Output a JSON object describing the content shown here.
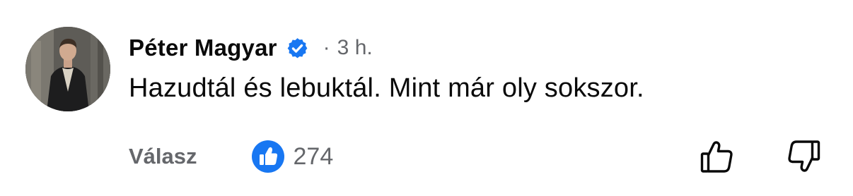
{
  "comment": {
    "author": "Péter Magyar",
    "verified": true,
    "separator": "·",
    "time": "3 h.",
    "text": "Hazudtál és lebuktál. Mint már oly sokszor."
  },
  "actions": {
    "reply_label": "Válasz",
    "reaction_count": "274"
  },
  "icons": {
    "verified": "verified-badge-icon",
    "like": "like-thumb-icon",
    "upvote": "thumbs-up-outline-icon",
    "downvote": "thumbs-down-outline-icon"
  },
  "colors": {
    "verified_blue": "#1877f2",
    "like_blue": "#1877f2",
    "secondary_text": "#65676b",
    "primary_text": "#0a0a0a"
  }
}
